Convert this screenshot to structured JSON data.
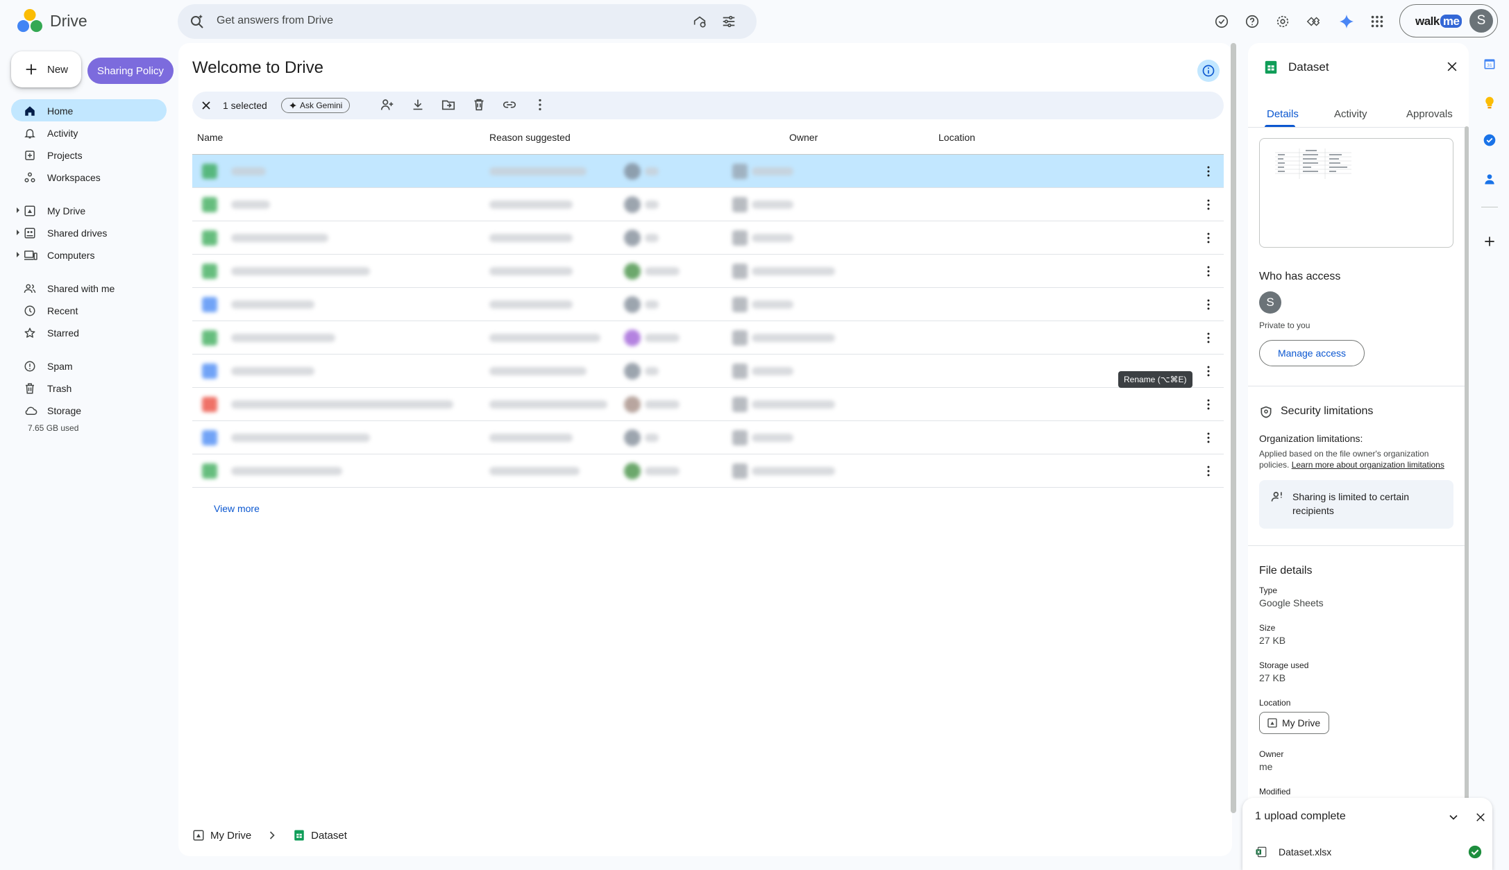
{
  "app": {
    "name": "Drive"
  },
  "search": {
    "placeholder": "Get answers from Drive"
  },
  "account": {
    "brand_walk": "walk",
    "brand_me": "me",
    "avatar_letter": "S"
  },
  "sidebar": {
    "new_label": "New",
    "policy_label": "Sharing Policy",
    "items": [
      {
        "label": "Home",
        "icon": "home-icon"
      },
      {
        "label": "Activity",
        "icon": "bell-icon"
      },
      {
        "label": "Projects",
        "icon": "projects-icon"
      },
      {
        "label": "Workspaces",
        "icon": "workspaces-icon"
      },
      {
        "label": "My Drive",
        "icon": "my-drive-icon"
      },
      {
        "label": "Shared drives",
        "icon": "shared-drives-icon"
      },
      {
        "label": "Computers",
        "icon": "computers-icon"
      },
      {
        "label": "Shared with me",
        "icon": "people-icon"
      },
      {
        "label": "Recent",
        "icon": "clock-icon"
      },
      {
        "label": "Starred",
        "icon": "star-icon"
      },
      {
        "label": "Spam",
        "icon": "spam-icon"
      },
      {
        "label": "Trash",
        "icon": "trash-icon"
      },
      {
        "label": "Storage",
        "icon": "cloud-icon"
      }
    ],
    "storage_used": "7.65 GB used"
  },
  "main": {
    "title": "Welcome to Drive",
    "selection": {
      "count_label": "1 selected",
      "gemini_label": "Ask Gemini"
    },
    "columns": [
      "Name",
      "Reason suggested",
      "Owner",
      "Location"
    ],
    "view_more": "View more",
    "tooltip": "Rename (⌥⌘E)"
  },
  "breadcrumb": {
    "root": "My Drive",
    "file": "Dataset"
  },
  "details": {
    "title": "Dataset",
    "tabs": [
      "Details",
      "Activity",
      "Approvals"
    ],
    "who_has_access": "Who has access",
    "avatar_letter": "S",
    "private_label": "Private to you",
    "manage_label": "Manage access",
    "security_title": "Security limitations",
    "org_limitations": "Organization limitations:",
    "org_text": "Applied based on the file owner's organization policies.",
    "org_link": "Learn more about organization limitations",
    "sharing_limited": "Sharing is limited to certain recipients",
    "file_details_title": "File details",
    "type_label": "Type",
    "type_value": "Google Sheets",
    "size_label": "Size",
    "size_value": "27 KB",
    "storage_label": "Storage used",
    "storage_value": "27 KB",
    "location_label": "Location",
    "location_value": "My Drive",
    "owner_label": "Owner",
    "owner_value": "me",
    "modified_label": "Modified"
  },
  "upload": {
    "title": "1 upload complete",
    "file": "Dataset.xlsx"
  },
  "colors": {
    "accent": "#0b57d0",
    "selected_bg": "#c2e7ff",
    "policy_btn": "#7c6bdd",
    "sheets_green": "#0f9d58"
  }
}
